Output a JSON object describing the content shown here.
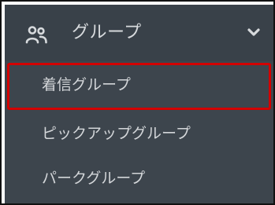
{
  "menu": {
    "group": {
      "label": "グループ",
      "icon": "users-icon",
      "expand_icon": "chevron-down-icon"
    },
    "items": [
      {
        "label": "着信グループ",
        "highlighted": true
      },
      {
        "label": "ピックアップグループ",
        "highlighted": false
      },
      {
        "label": "パークグループ",
        "highlighted": false
      }
    ]
  },
  "colors": {
    "menu_background": "#3d454d",
    "header_background": "#394149",
    "text": "#d7dadd",
    "highlight_border": "#d30000",
    "frame_border": "#111111"
  }
}
